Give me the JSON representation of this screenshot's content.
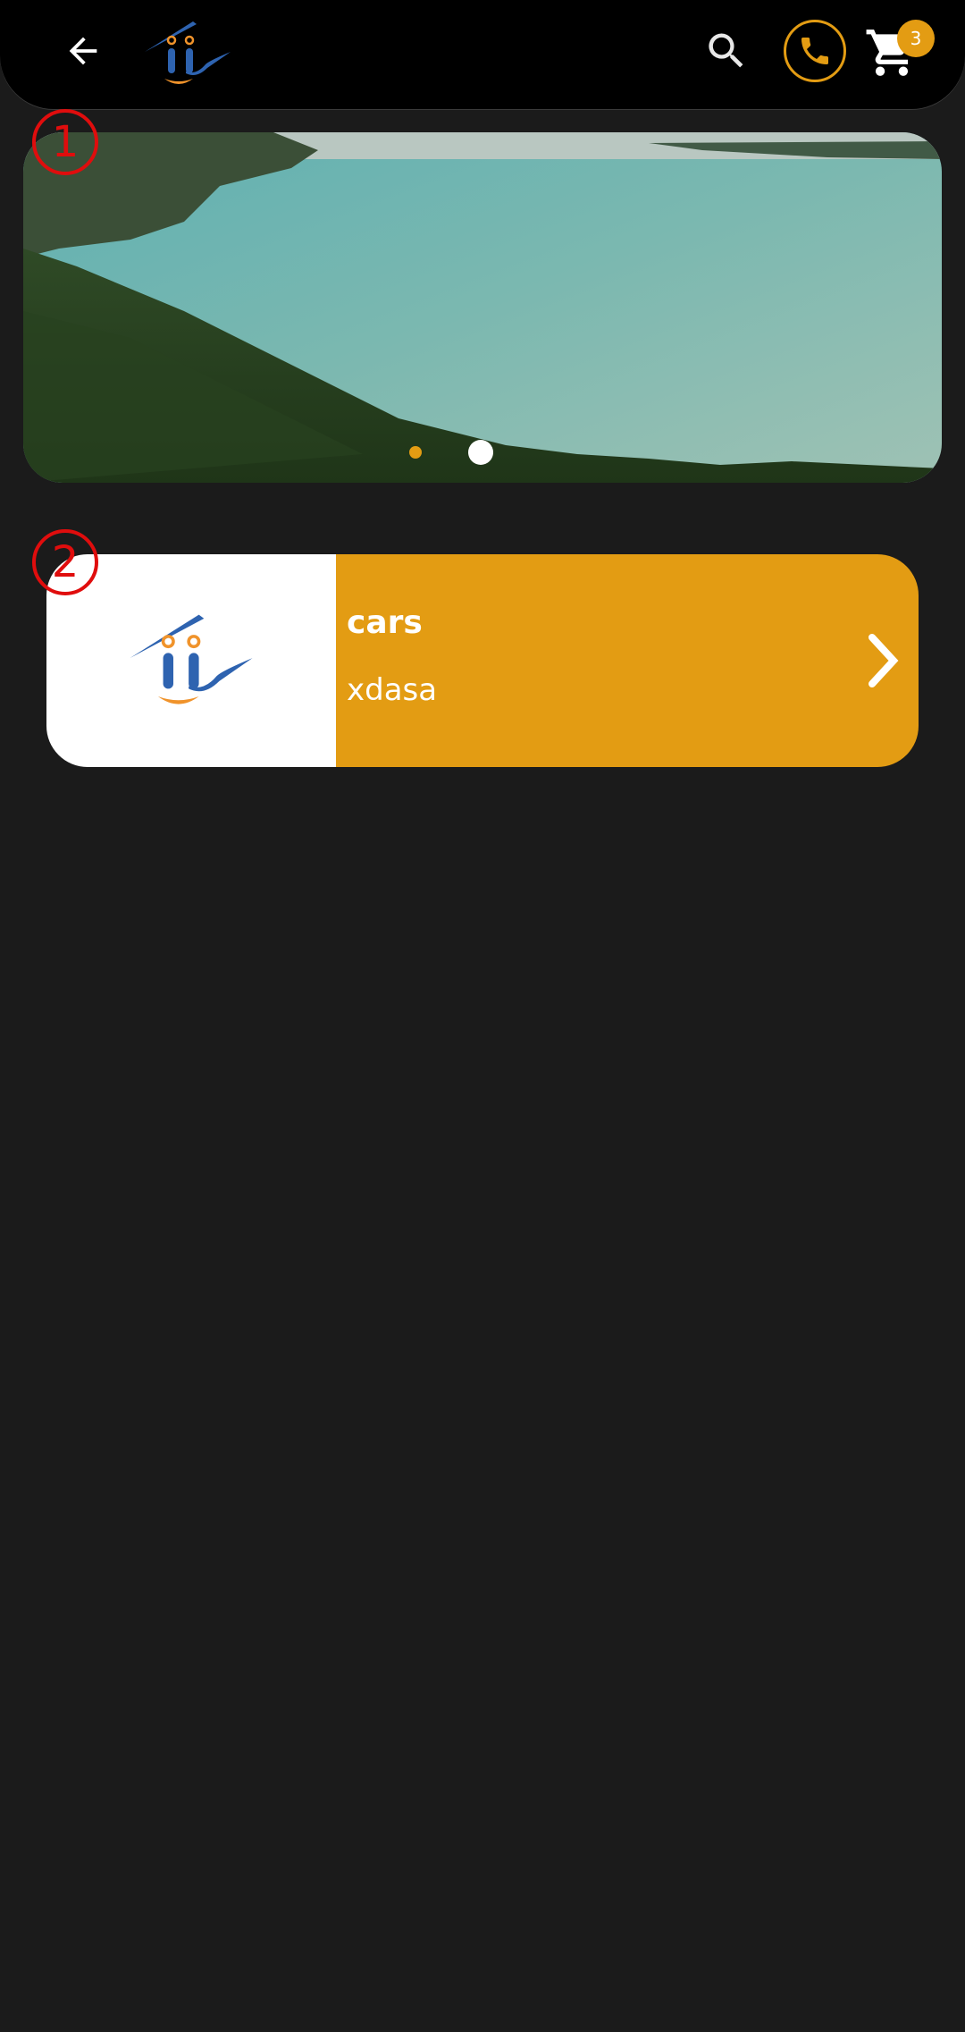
{
  "header": {
    "back_icon": "arrow-left-icon",
    "logo": "app-logo",
    "search_icon": "search-icon",
    "phone_icon": "phone-icon",
    "cart_icon": "cart-icon",
    "cart_count": "3",
    "accent_color": "#e39c13"
  },
  "markers": [
    "1",
    "2"
  ],
  "banner": {
    "slide_count": 2,
    "active_slide": 2
  },
  "category_card": {
    "title": "cars",
    "subtitle": "xdasa",
    "chevron_icon": "chevron-right-icon"
  }
}
